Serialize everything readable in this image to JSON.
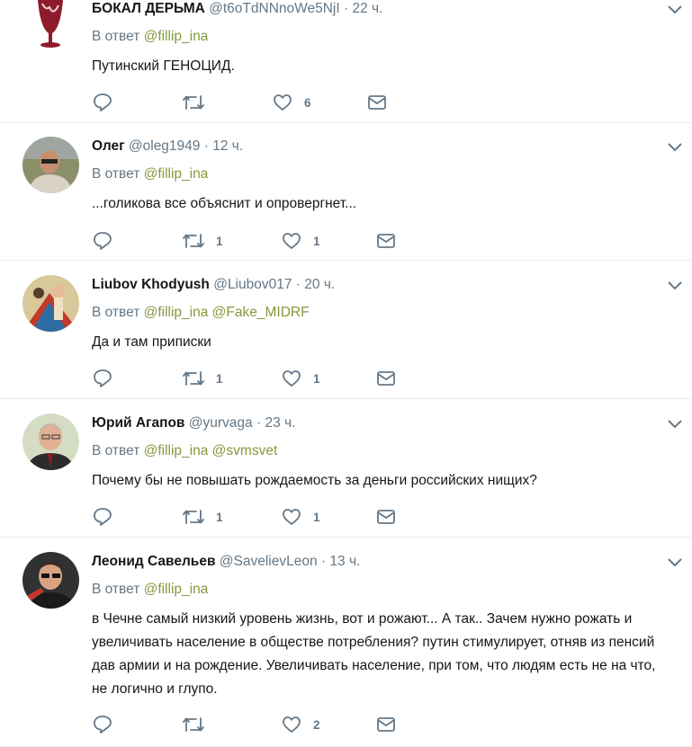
{
  "tweets": [
    {
      "name": "БОКАЛ ДЕРЬМА",
      "handle": "@t6oTdNNnoWe5NjI",
      "dot": "·",
      "time": "22 ч.",
      "reply_prefix": "В ответ",
      "reply_to": [
        "@fillip_ina"
      ],
      "text": "Путинский ГЕНОЦИД.",
      "replies": "",
      "retweets": "",
      "likes": "6"
    },
    {
      "name": "Олег",
      "handle": "@oleg1949",
      "dot": "·",
      "time": "12 ч.",
      "reply_prefix": "В ответ",
      "reply_to": [
        "@fillip_ina"
      ],
      "text": "...голикова все объяснит и опровергнет...",
      "replies": "",
      "retweets": "1",
      "likes": "1"
    },
    {
      "name": "Liubov Khodyush",
      "handle": "@Liubov017",
      "dot": "·",
      "time": "20 ч.",
      "reply_prefix": "В ответ",
      "reply_to": [
        "@fillip_ina",
        "@Fake_MIDRF"
      ],
      "text": "Да и там приписки",
      "replies": "",
      "retweets": "1",
      "likes": "1"
    },
    {
      "name": "Юрий Агапов",
      "handle": "@yurvaga",
      "dot": "·",
      "time": "23 ч.",
      "reply_prefix": "В ответ",
      "reply_to": [
        "@fillip_ina",
        "@svmsvet"
      ],
      "text": "Почему бы не повышать рождаемость за деньги российских нищих?",
      "replies": "",
      "retweets": "1",
      "likes": "1"
    },
    {
      "name": "Леонид Савельев",
      "handle": "@SavelievLeon",
      "dot": "·",
      "time": "13 ч.",
      "reply_prefix": "В ответ",
      "reply_to": [
        "@fillip_ina"
      ],
      "text": "в Чечне самый низкий уровень жизнь, вот и рожают... А так.. Зачем нужно рожать и увеличивать население в обществе потребления? путин стимулирует, отняв из пенсий дав армии и на рождение. Увеличивать население, при том, что людям есть не на что, не логично и глупо.",
      "replies": "",
      "retweets": "",
      "likes": "2"
    }
  ],
  "icons": {
    "reply": "reply-icon",
    "retweet": "retweet-icon",
    "like": "heart-icon",
    "dm": "direct-message-icon",
    "more": "chevron-down-icon"
  },
  "colors": {
    "link": "#849a3e",
    "secondary": "#657786",
    "text": "#14171a",
    "divider": "#e6ecf0"
  }
}
